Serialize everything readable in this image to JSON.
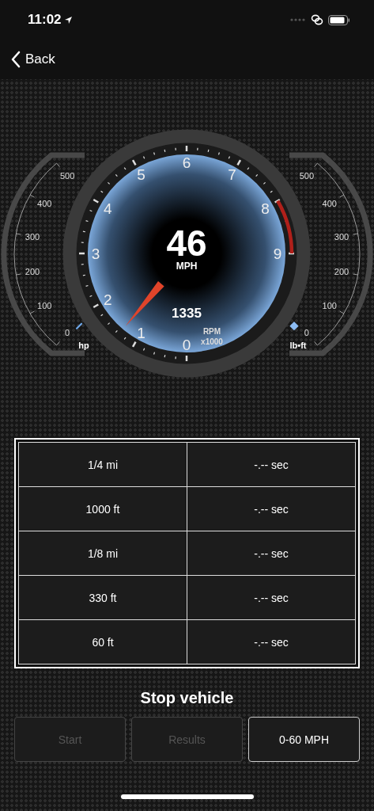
{
  "status_bar": {
    "time": "11:02"
  },
  "nav": {
    "back": "Back"
  },
  "gauge": {
    "speed": "46",
    "speed_unit": "MPH",
    "rpm": "1335",
    "rpm_unit": "RPM",
    "rpm_scale": "x1000",
    "dial_numbers": [
      "0",
      "1",
      "2",
      "3",
      "4",
      "5",
      "6",
      "7",
      "8",
      "9"
    ],
    "left_scale": {
      "unit": "hp",
      "labels": [
        "0",
        "100",
        "200",
        "300",
        "400",
        "500"
      ]
    },
    "right_scale": {
      "unit": "lb•ft",
      "labels": [
        "0",
        "100",
        "200",
        "300",
        "400",
        "500"
      ]
    }
  },
  "times": [
    {
      "distance": "1/4 mi",
      "time": "-.-- sec"
    },
    {
      "distance": "1000 ft",
      "time": "-.-- sec"
    },
    {
      "distance": "1/8 mi",
      "time": "-.-- sec"
    },
    {
      "distance": "330 ft",
      "time": "-.-- sec"
    },
    {
      "distance": "60 ft",
      "time": "-.-- sec"
    }
  ],
  "status": "Stop vehicle",
  "buttons": [
    {
      "label": "Start",
      "disabled": true
    },
    {
      "label": "Results",
      "disabled": true
    },
    {
      "label": "0-60 MPH",
      "disabled": false
    }
  ]
}
